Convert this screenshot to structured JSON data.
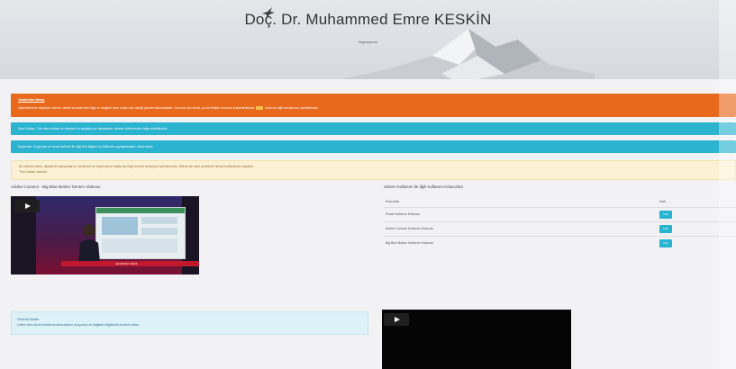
{
  "header": {
    "title": "Doç. Dr. Muhammed Emre KESKİN",
    "subtitle": "bilgisayarlar"
  },
  "alerts": {
    "orange": {
      "heading": "Tarafımdan Mesaj",
      "body_before": "Ziyaretlerinize teşekkür ederim, sitede sunulan tüm bilgi ve belgeler ders notları için içeriği güncel tutulmaktadır. Sorunuz için email, ya da iletişim formunu kullanabilirsiniz",
      "body_after": "Konu ile ilgili sorularınızı yazabilirsiniz."
    },
    "blue1": "Ders Notları: Tüm ders notları ve ödevleri bu sayfada yer almaktadır, dersler bölümünden takip edebilirsiniz.",
    "blue2": "Duyurular: Duyurular ve sınav tarihleri ile ilgili tüm bilgiler bu bölümde paylaşılacaktır, takip ediniz.",
    "yellow_line1": "Bu internet sitesi, akademik çalışmalarım, derslerim ve duyurularım hakkında bilgi vermek amacıyla hazırlanmıştır. Sitede yer alan içeriklerin izinsiz kullanılması yasaktır.",
    "yellow_line2": "Tüm hakları saklıdır."
  },
  "left": {
    "section_title": "Adobe Connect - Big Blue Button Tanıtım Videosu",
    "video_caption": "ÇEVRİMİÇİ DERS",
    "info_title": "Önemli Notlar",
    "info_body": "Lütfen ders öncesi kullanım kılavuzlarını okuyunuz ve bağlantı bilgilerinizi kontrol ediniz."
  },
  "right": {
    "section_title": "Sistem Kullanım ile İlgili Kullanım Kılavuzları",
    "table": {
      "col_a": "Kılavuzlar",
      "col_b": "İndir",
      "rows": [
        {
          "name": "Portal Kullanım Kılavuzu",
          "action": "İndir"
        },
        {
          "name": "Adobe Connect Kullanım Kılavuzu",
          "action": "İndir"
        },
        {
          "name": "Big Blue Button Kullanım Kılavuzu",
          "action": "İndir"
        }
      ]
    }
  },
  "colors": {
    "orange": "#e8691c",
    "blue": "#2bb3cf",
    "yellow": "#fcf1d4",
    "button": "#28b4d0"
  },
  "icons": [
    "bird-logo-icon",
    "play-icon"
  ]
}
